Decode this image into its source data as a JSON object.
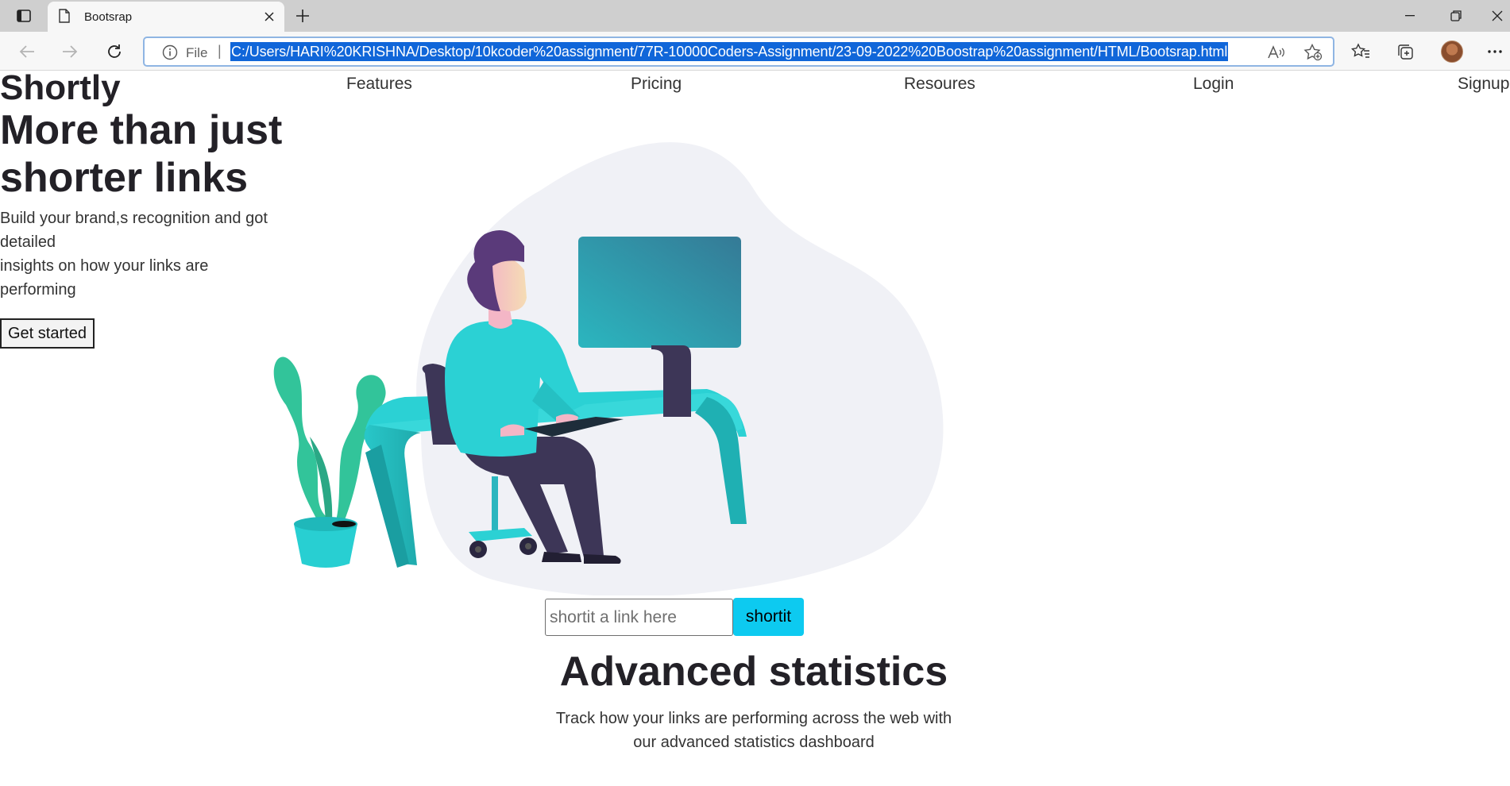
{
  "browser": {
    "tab_title": "Bootsrap",
    "address_prefix": "File",
    "url": "C:/Users/HARI%20KRISHNA/Desktop/10kcoder%20assignment/77R-10000Coders-Assignment/23-09-2022%20Boostrap%20assignment/HTML/Bootsrap.html",
    "icons": [
      "tab-actions-icon",
      "file-icon",
      "close-icon",
      "plus-icon",
      "minimize-icon",
      "restore-icon",
      "back-icon",
      "forward-icon",
      "refresh-icon",
      "info-icon",
      "read-aloud-icon",
      "add-favorite-icon",
      "favorites-icon",
      "collections-icon",
      "more-icon"
    ]
  },
  "header": {
    "brand": "Shortly",
    "nav": [
      "Features",
      "Pricing",
      "Resoures",
      "Login",
      "Signup"
    ]
  },
  "hero": {
    "title": "More than just shorter links",
    "text_line1": "Build your brand,s recognition and got detailed",
    "text_line2": "insights on how your links are performing",
    "cta": "Get started"
  },
  "shorten": {
    "placeholder": "shortit a link here",
    "button": "shortit"
  },
  "stats": {
    "title": "Advanced statistics",
    "text_line1": "Track how your links are performing across the web with",
    "text_line2": "our advanced statistics dashboard"
  },
  "colors": {
    "accent": "#0dcaf0",
    "illustration_teal": "#2bd1d4",
    "illustration_blob": "#f0f1f6",
    "text_dark": "#232127",
    "url_highlight": "#1066d9"
  }
}
